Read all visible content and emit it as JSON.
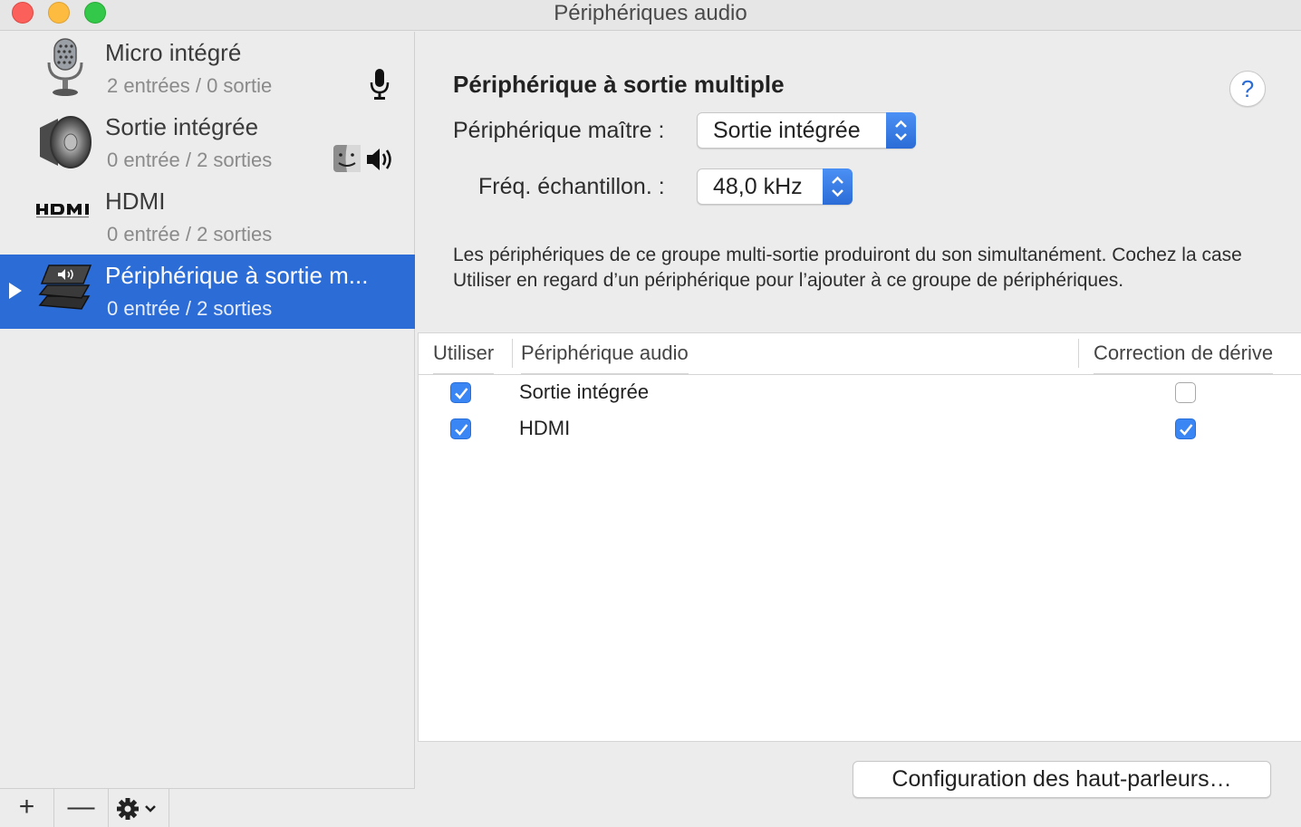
{
  "window": {
    "title": "Périphériques audio"
  },
  "sidebar": {
    "devices": [
      {
        "name": "Micro intégré",
        "io": "2 entrées / 0 sortie",
        "icon": "microphone-icon"
      },
      {
        "name": "Sortie intégrée",
        "io": "0 entrée / 2 sorties",
        "icon": "speaker-icon"
      },
      {
        "name": "HDMI",
        "io": "0 entrée / 2 sorties",
        "icon": "hdmi-logo"
      },
      {
        "name": "Périphérique à sortie m...",
        "io": "0 entrée / 2 sorties",
        "icon": "multi-output-icon",
        "selected": true
      }
    ],
    "toolbar": {
      "add_label": "+",
      "remove_label": "—",
      "gear_icon": "gear-icon"
    }
  },
  "detail": {
    "title": "Périphérique à sortie multiple",
    "help_label": "?",
    "master_label": "Périphérique maître :",
    "master_value": "Sortie intégrée",
    "rate_label": "Fréq. échantillon. :",
    "rate_value": "48,0 kHz",
    "description": "Les périphériques de ce groupe multi-sortie produiront du son simultanément. Cochez la case Utiliser en regard d’un périphérique pour l’ajouter à ce groupe de périphériques.",
    "table": {
      "headers": [
        "Utiliser",
        "Périphérique audio",
        "Correction de dérive"
      ],
      "rows": [
        {
          "use": true,
          "device": "Sortie intégrée",
          "drift": false
        },
        {
          "use": true,
          "device": "HDMI",
          "drift": true
        }
      ]
    },
    "config_button": "Configuration des haut-parleurs…"
  },
  "colors": {
    "accent": "#2b6cd6",
    "checkbox": "#3a86f5"
  }
}
